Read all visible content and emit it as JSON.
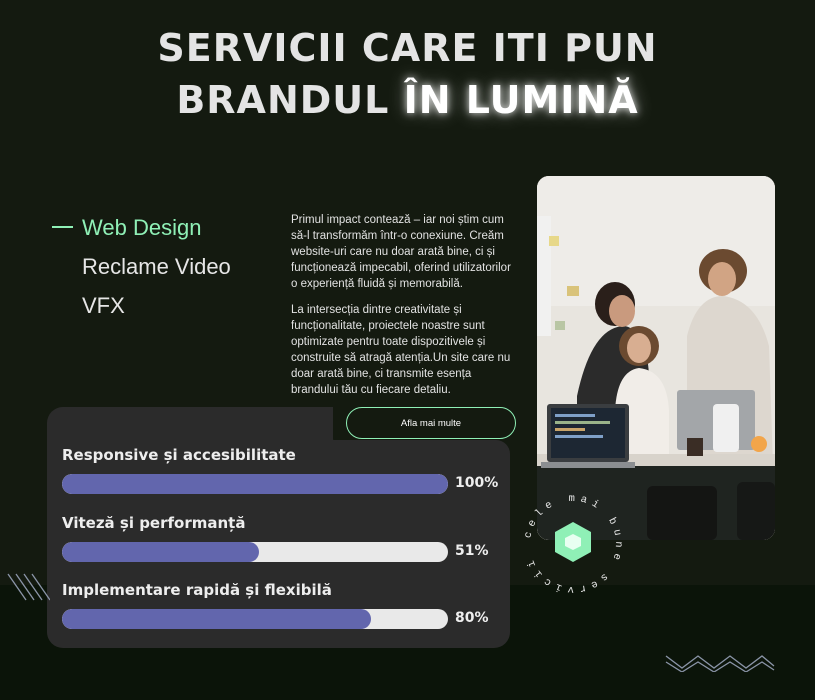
{
  "header": {
    "title_line1": "SERVICII CARE ITI PUN",
    "title_line2_plain": "BRANDUL ",
    "title_line2_glow": "ÎN LUMINĂ"
  },
  "services": {
    "tabs": [
      {
        "label": "Web Design",
        "active": true
      },
      {
        "label": "Reclame Video",
        "active": false
      },
      {
        "label": "VFX",
        "active": false
      }
    ]
  },
  "description": {
    "p1": "Primul impact contează – iar noi știm cum să-l transformăm într-o conexiune. Creăm website-uri care nu doar arată bine, ci și funcționează impecabil, oferind utilizatorilor o experiență fluidă și memorabilă.",
    "p2": "La intersecția dintre creativitate și funcționalitate, proiectele noastre sunt optimizate pentru toate dispozitivele și construite să atragă atenția.Un site care nu doar arată bine, ci transmite esența brandului tău cu fiecare detaliu."
  },
  "cta": {
    "label": "Afla mai multe"
  },
  "stats": [
    {
      "label": "Responsive și accesibilitate",
      "value": 100,
      "display": "100%"
    },
    {
      "label": "Viteză și performanță",
      "value": 51,
      "display": "51%"
    },
    {
      "label": "Implementare rapidă și flexibilă",
      "value": 80,
      "display": "80%"
    }
  ],
  "badge": {
    "text": "cele mai bune servicii"
  },
  "colors": {
    "background": "#141a10",
    "accent_green": "#8ff0b6",
    "bar_fill": "#6266ad",
    "card": "#2b2b2b"
  }
}
